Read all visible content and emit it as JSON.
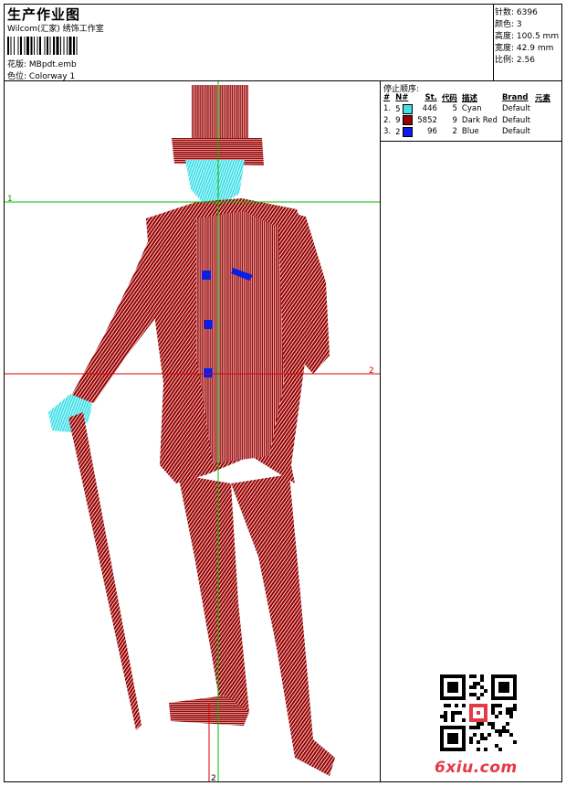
{
  "header": {
    "title": "生产作业图",
    "studio": "Wilcom(汇家) 绣饰工作室",
    "design_label": "花版:",
    "design_value": "MBpdt.emb",
    "colorway_label": "色位:",
    "colorway_value": "Colorway 1"
  },
  "stats": [
    {
      "label": "针数:",
      "value": "6396"
    },
    {
      "label": "颜色:",
      "value": "3"
    },
    {
      "label": "高度:",
      "value": "100.5 mm"
    },
    {
      "label": "宽度:",
      "value": "42.9 mm"
    },
    {
      "label": "比例:",
      "value": "2.56"
    }
  ],
  "stop_sequence": {
    "title": "停止顺序:",
    "headers": [
      "#",
      "N#",
      "St.",
      "代码",
      "描述",
      "Brand",
      "元素"
    ],
    "rows": [
      {
        "idx": "1.",
        "n": "5",
        "color": "#3fe0e8",
        "st": "446",
        "code": "5",
        "desc": "Cyan",
        "brand": "Default"
      },
      {
        "idx": "2.",
        "n": "9",
        "color": "#990000",
        "st": "5852",
        "code": "9",
        "desc": "Dark Red",
        "brand": "Default"
      },
      {
        "idx": "3.",
        "n": "2",
        "color": "#0a1ee6",
        "st": "96",
        "code": "2",
        "desc": "Blue",
        "brand": "Default"
      }
    ]
  },
  "axes": {
    "h_label_left": "1",
    "h_label_right": "2",
    "v_label_bottom": "2"
  },
  "colors": {
    "dark_red": "#990000",
    "cyan": "#3fe0e8",
    "blue": "#0a1ee6",
    "guide_green": "#00c000",
    "guide_red": "#e00000"
  },
  "watermark": {
    "text": "6xiu.com",
    "qr_icon": "qr-code-icon"
  }
}
